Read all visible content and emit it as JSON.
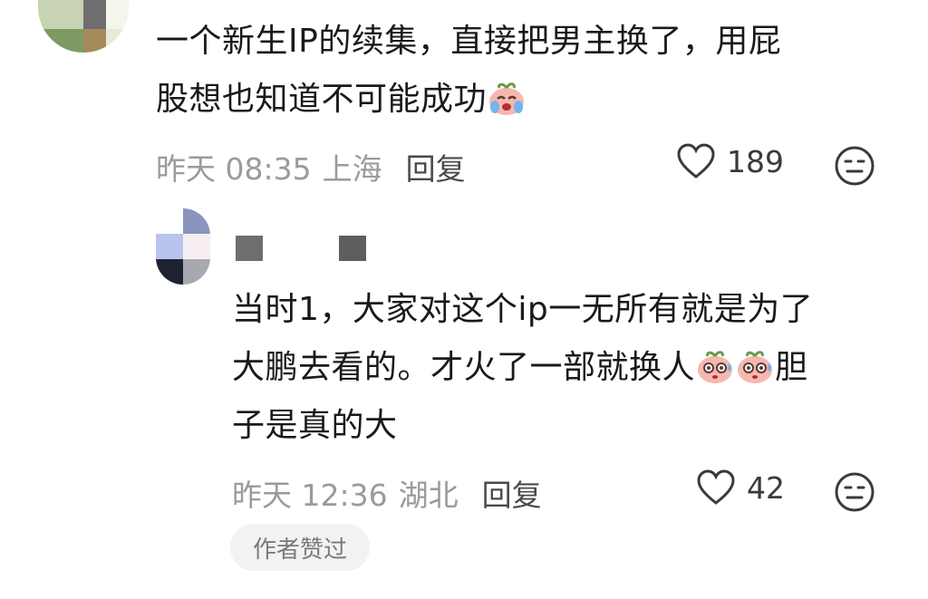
{
  "comment1": {
    "text_line1": "一个新生IP的续集，直接把男主换了，用屁",
    "text_line2": "股想也知道不可能成功",
    "emoji_icon": "crying-peach-emoji",
    "time": "昨天 08:35",
    "location": "上海",
    "reply_label": "回复",
    "like_count": "189"
  },
  "comment2": {
    "text_line1": "当时1，大家对这个ip一无所有就是为了",
    "text_line2a": "大鹏去看的。才火了一部就换人",
    "text_line2b": "胆",
    "text_line3": "子是真的大",
    "emoji_icon": "sweating-peach-emoji",
    "time": "昨天 12:36",
    "location": "湖北",
    "reply_label": "回复",
    "like_count": "42",
    "author_badge": "作者赞过"
  },
  "icons": {
    "like": "heart-outline-icon",
    "dislike": "neutral-face-icon"
  },
  "colors": {
    "text": "#1a1a1a",
    "meta": "#9b9b9b",
    "badge_bg": "#f2f2f2"
  }
}
